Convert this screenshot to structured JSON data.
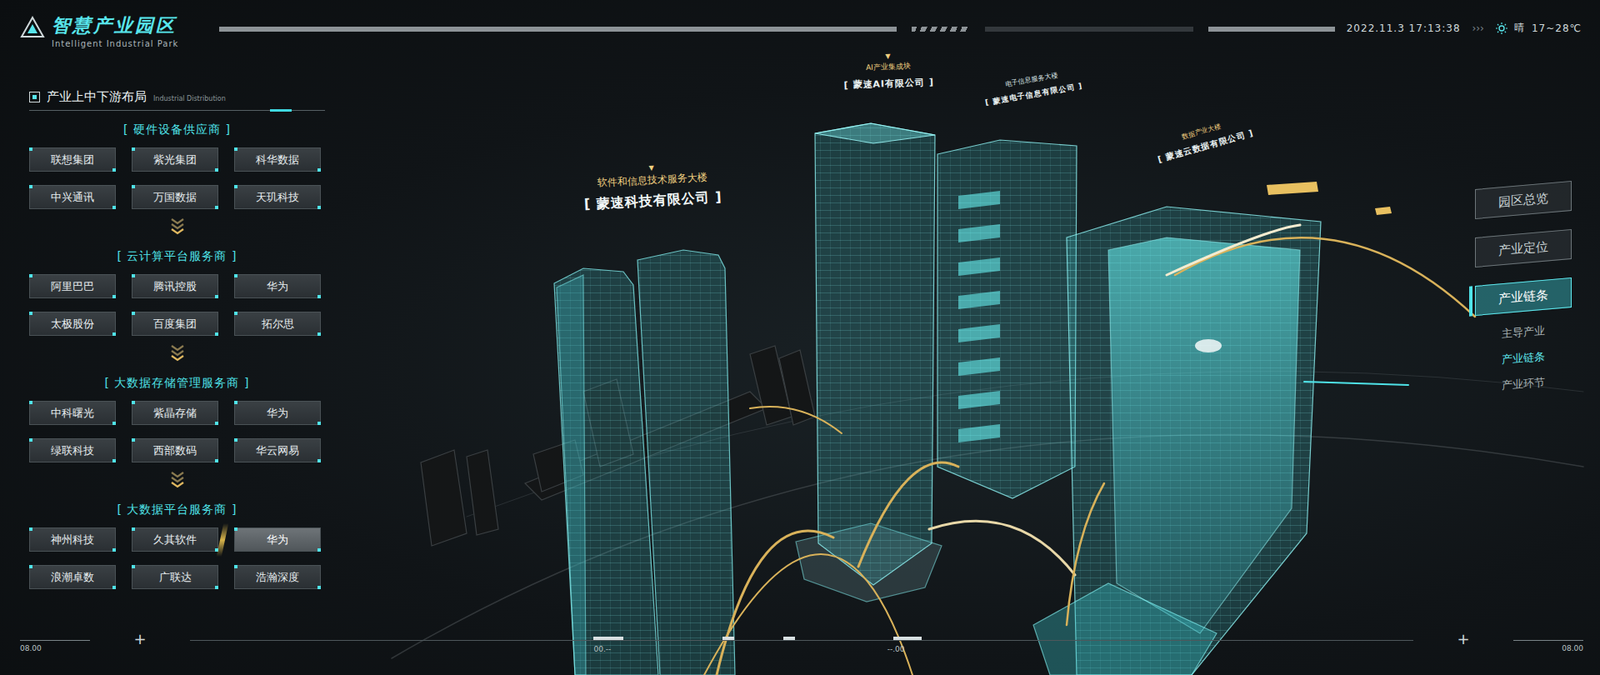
{
  "header": {
    "title": "智慧产业园区",
    "subtitle": "Intelligent Industrial Park",
    "datetime": "2022.11.3 17:13:38",
    "arrows": "›››",
    "weather": "晴",
    "temperature": "17~28℃"
  },
  "left_panel": {
    "title": "产业上中下游布局",
    "subtitle": "Industrial Distribution",
    "groups": [
      {
        "title": "[ 硬件设备供应商 ]",
        "items": [
          {
            "label": "联想集团",
            "selected": false
          },
          {
            "label": "紫光集团",
            "selected": false
          },
          {
            "label": "科华数据",
            "selected": false
          },
          {
            "label": "中兴通讯",
            "selected": false
          },
          {
            "label": "万国数据",
            "selected": false
          },
          {
            "label": "天玑科技",
            "selected": false
          }
        ]
      },
      {
        "title": "[ 云计算平台服务商 ]",
        "items": [
          {
            "label": "阿里巴巴",
            "selected": false
          },
          {
            "label": "腾讯控股",
            "selected": false
          },
          {
            "label": "华为",
            "selected": false
          },
          {
            "label": "太极股份",
            "selected": false
          },
          {
            "label": "百度集团",
            "selected": false
          },
          {
            "label": "拓尔思",
            "selected": false
          }
        ]
      },
      {
        "title": "[ 大数据存储管理服务商 ]",
        "items": [
          {
            "label": "中科曙光",
            "selected": false
          },
          {
            "label": "紫晶存储",
            "selected": false
          },
          {
            "label": "华为",
            "selected": false
          },
          {
            "label": "绿联科技",
            "selected": false
          },
          {
            "label": "西部数码",
            "selected": false
          },
          {
            "label": "华云网易",
            "selected": false
          }
        ]
      },
      {
        "title": "[ 大数据平台服务商 ]",
        "items": [
          {
            "label": "神州科技",
            "selected": false
          },
          {
            "label": "久其软件",
            "selected": false
          },
          {
            "label": "华为",
            "selected": true
          },
          {
            "label": "浪潮卓数",
            "selected": false
          },
          {
            "label": "广联达",
            "selected": false
          },
          {
            "label": "浩瀚深度",
            "selected": false
          }
        ]
      }
    ]
  },
  "buildings": [
    {
      "marker": "▼",
      "caption": "软件和信息技术服务大楼",
      "company": "[ 蒙速科技有限公司 ]"
    },
    {
      "marker": "▼",
      "caption": "AI产业集成块",
      "company": "[ 蒙速AI有限公司 ]"
    },
    {
      "marker": "",
      "caption": "电子信息服务大楼",
      "company": "[ 蒙速电子信息有限公司 ]"
    },
    {
      "marker": "",
      "caption": "数据产业大楼",
      "company": "[ 蒙速云数据有限公司 ]"
    }
  ],
  "nav": {
    "items": [
      {
        "label": "园区总览",
        "selected": false
      },
      {
        "label": "产业定位",
        "selected": false
      },
      {
        "label": "产业链条",
        "selected": true
      }
    ],
    "subitems": [
      {
        "label": "主导产业",
        "selected": false
      },
      {
        "label": "产业链条",
        "selected": true
      },
      {
        "label": "产业环节",
        "selected": false
      }
    ]
  },
  "timeline": {
    "start": "08.00",
    "end": "08.00",
    "plus_left": "+",
    "plus_right": "+",
    "marks": [
      "00.--",
      "--.00"
    ]
  }
}
